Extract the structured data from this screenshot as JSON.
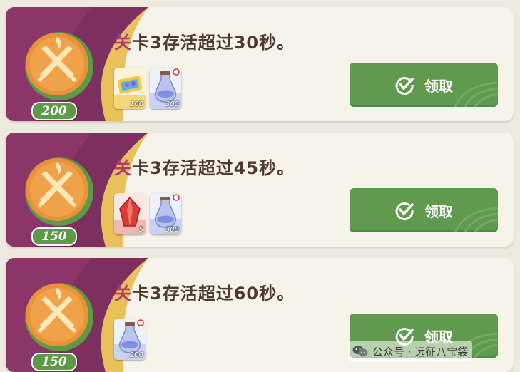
{
  "tasks": [
    {
      "prefix": "关",
      "rest": "卡3存活超过30秒。",
      "points": "200",
      "rewards": [
        {
          "icon": "ticket-icon",
          "qty": "100"
        },
        {
          "icon": "potion-icon",
          "qty": "300"
        }
      ],
      "button": "领取"
    },
    {
      "prefix": "关",
      "rest": "卡3存活超过45秒。",
      "points": "150",
      "rewards": [
        {
          "icon": "red-crystal-icon",
          "qty": "5"
        },
        {
          "icon": "potion-icon",
          "qty": "300"
        }
      ],
      "button": "领取"
    },
    {
      "prefix": "关",
      "rest": "卡3存活超过60秒。",
      "points": "150",
      "rewards": [
        {
          "icon": "potion-icon",
          "qty": "200"
        }
      ],
      "button": "领取"
    }
  ],
  "watermark": {
    "text": "公众号 · 远征八宝袋"
  },
  "colors": {
    "button": "#5f9a4e",
    "badge": "#e8923a",
    "purple": "#7a2e5e"
  }
}
